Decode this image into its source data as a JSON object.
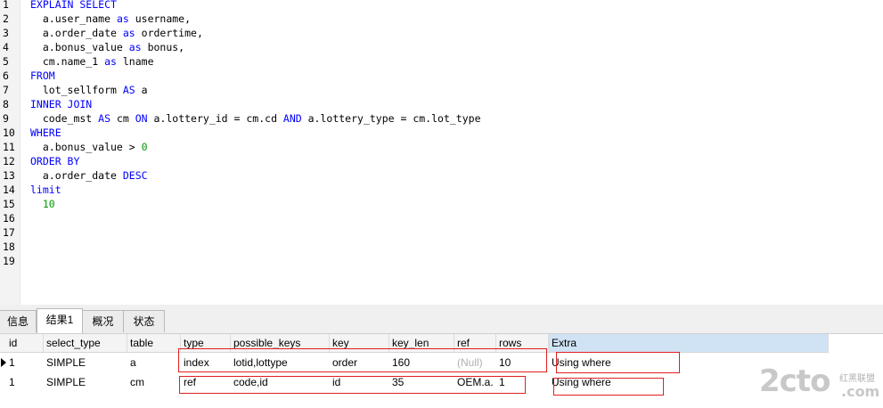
{
  "editor": {
    "line_numbers": [
      "1",
      "2",
      "3",
      "4",
      "5",
      "6",
      "7",
      "8",
      "9",
      "10",
      "11",
      "12",
      "13",
      "14",
      "15",
      "16",
      "17",
      "18",
      "19"
    ],
    "lines": [
      [
        {
          "t": "EXPLAIN SELECT",
          "c": "kw"
        }
      ],
      [
        {
          "t": "  a.user_name ",
          "c": ""
        },
        {
          "t": "as",
          "c": "kw"
        },
        {
          "t": " username,",
          "c": ""
        }
      ],
      [
        {
          "t": "  a.order_date ",
          "c": ""
        },
        {
          "t": "as",
          "c": "kw"
        },
        {
          "t": " ordertime,",
          "c": ""
        }
      ],
      [
        {
          "t": "  a.bonus_value ",
          "c": ""
        },
        {
          "t": "as",
          "c": "kw"
        },
        {
          "t": " bonus,",
          "c": ""
        }
      ],
      [
        {
          "t": "  cm.name_1 ",
          "c": ""
        },
        {
          "t": "as",
          "c": "kw"
        },
        {
          "t": " lname",
          "c": ""
        }
      ],
      [
        {
          "t": "FROM",
          "c": "kw"
        }
      ],
      [
        {
          "t": "  lot_sellform ",
          "c": ""
        },
        {
          "t": "AS",
          "c": "kw"
        },
        {
          "t": " a",
          "c": ""
        }
      ],
      [
        {
          "t": "INNER JOIN",
          "c": "kw"
        }
      ],
      [
        {
          "t": "  code_mst ",
          "c": ""
        },
        {
          "t": "AS",
          "c": "kw"
        },
        {
          "t": " cm ",
          "c": ""
        },
        {
          "t": "ON",
          "c": "kw"
        },
        {
          "t": " a.lottery_id = cm.cd ",
          "c": ""
        },
        {
          "t": "AND",
          "c": "kw"
        },
        {
          "t": " a.lottery_type = cm.lot_type",
          "c": ""
        }
      ],
      [
        {
          "t": "WHERE",
          "c": "kw"
        }
      ],
      [
        {
          "t": "  a.bonus_value > ",
          "c": ""
        },
        {
          "t": "0",
          "c": "num"
        }
      ],
      [
        {
          "t": "ORDER BY",
          "c": "kw"
        }
      ],
      [
        {
          "t": "  a.order_date ",
          "c": ""
        },
        {
          "t": "DESC",
          "c": "kw"
        }
      ],
      [
        {
          "t": "limit",
          "c": "kw"
        }
      ],
      [
        {
          "t": "  ",
          "c": ""
        },
        {
          "t": "10",
          "c": "num"
        }
      ]
    ]
  },
  "tabs": [
    {
      "label": "信息",
      "active": false
    },
    {
      "label": "结果1",
      "active": true
    },
    {
      "label": "概况",
      "active": false
    },
    {
      "label": "状态",
      "active": false
    }
  ],
  "grid": {
    "columns": [
      "id",
      "select_type",
      "table",
      "type",
      "possible_keys",
      "key",
      "key_len",
      "ref",
      "rows",
      "Extra"
    ],
    "rows": [
      {
        "id": "1",
        "select_type": "SIMPLE",
        "table": "a",
        "type": "index",
        "possible_keys": "lotid,lottype",
        "key": "order",
        "key_len": "160",
        "ref": "(Null)",
        "rows": "10",
        "Extra": "Using where"
      },
      {
        "id": "1",
        "select_type": "SIMPLE",
        "table": "cm",
        "type": "ref",
        "possible_keys": "code,id",
        "key": "id",
        "key_len": "35",
        "ref": "OEM.a.",
        "rows": "1",
        "Extra": "Using where"
      }
    ]
  },
  "watermark": {
    "main": "2cto",
    "sub": "红黑联盟",
    "suffix": ".com"
  },
  "colors": {
    "keyword": "#0000ff",
    "number": "#009900",
    "highlight_box": "#e02020",
    "extra_header": "#cfe3f5"
  }
}
